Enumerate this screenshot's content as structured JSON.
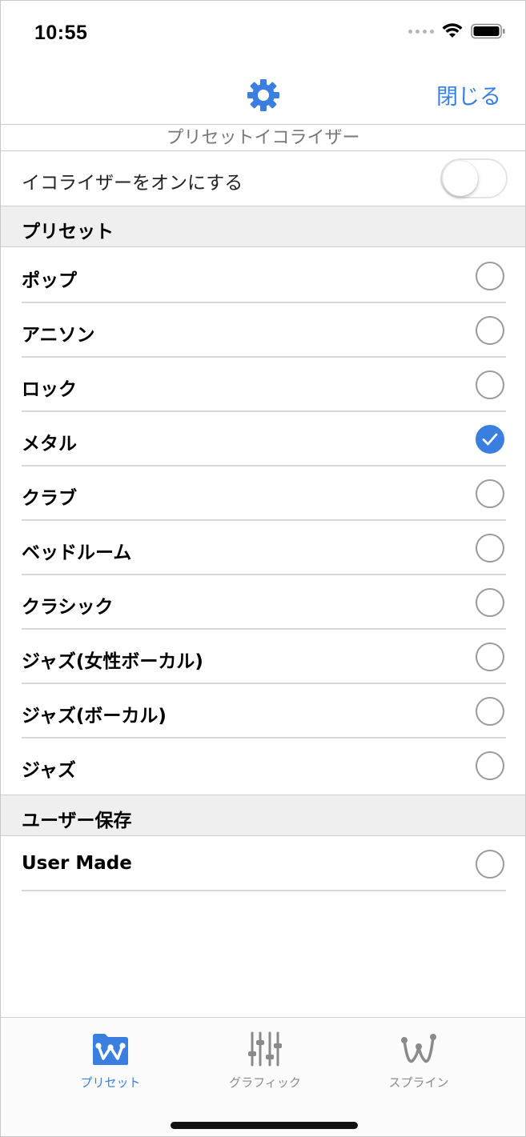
{
  "status_bar": {
    "time": "10:55"
  },
  "nav": {
    "gear_icon": "gear-icon",
    "close_label": "閉じる",
    "accent_color": "#3a7fe0"
  },
  "subtitle": "プリセットイコライザー",
  "equalizer_toggle": {
    "label": "イコライザーをオンにする",
    "on": false
  },
  "sections": [
    {
      "header": "プリセット",
      "items": [
        {
          "label": "ポップ",
          "selected": false
        },
        {
          "label": "アニソン",
          "selected": false
        },
        {
          "label": "ロック",
          "selected": false
        },
        {
          "label": "メタル",
          "selected": true
        },
        {
          "label": "クラブ",
          "selected": false
        },
        {
          "label": "ベッドルーム",
          "selected": false
        },
        {
          "label": "クラシック",
          "selected": false
        },
        {
          "label": "ジャズ(女性ボーカル)",
          "selected": false
        },
        {
          "label": "ジャズ(ボーカル)",
          "selected": false
        },
        {
          "label": "ジャズ",
          "selected": false
        }
      ]
    },
    {
      "header": "ユーザー保存",
      "items": [
        {
          "label": "User Made",
          "selected": false
        }
      ]
    }
  ],
  "tabs": [
    {
      "label": "プリセット",
      "icon": "preset-w-icon",
      "active": true
    },
    {
      "label": "グラフィック",
      "icon": "sliders-icon",
      "active": false
    },
    {
      "label": "スプライン",
      "icon": "spline-w-icon",
      "active": false
    }
  ],
  "colors": {
    "active_tab": "#3a7fe0",
    "inactive_tab": "#8a8a8a"
  }
}
